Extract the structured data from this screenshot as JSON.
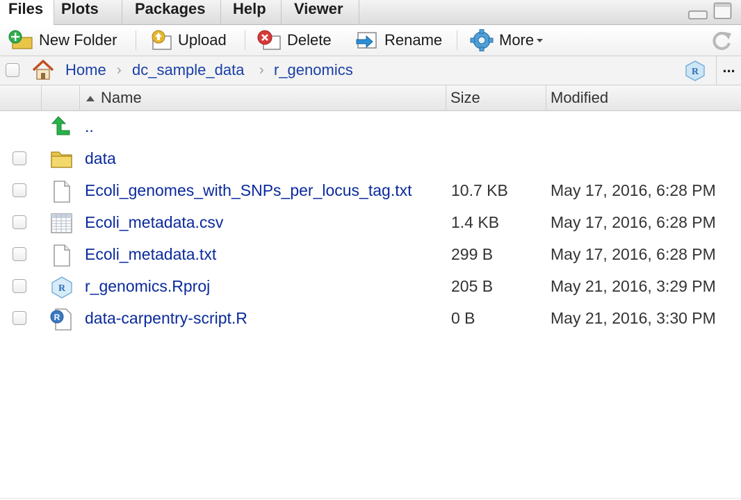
{
  "tabs": [
    {
      "label": "Files"
    },
    {
      "label": "Plots"
    },
    {
      "label": "Packages"
    },
    {
      "label": "Help"
    },
    {
      "label": "Viewer"
    }
  ],
  "toolbar": {
    "new_folder": "New Folder",
    "upload": "Upload",
    "delete": "Delete",
    "rename": "Rename",
    "more": "More"
  },
  "breadcrumb": {
    "items": [
      "Home",
      "dc_sample_data",
      "r_genomics"
    ],
    "more_label": "..."
  },
  "columns": {
    "name": "Name",
    "size": "Size",
    "modified": "Modified",
    "sort": "ascending"
  },
  "parent_dir": "..",
  "files": [
    {
      "name": "data",
      "size": "",
      "modified": "",
      "icon": "folder-icon"
    },
    {
      "name": "Ecoli_genomes_with_SNPs_per_locus_tag.txt",
      "size": "10.7 KB",
      "modified": "May 17, 2016, 6:28 PM",
      "icon": "text-file-icon"
    },
    {
      "name": "Ecoli_metadata.csv",
      "size": "1.4 KB",
      "modified": "May 17, 2016, 6:28 PM",
      "icon": "csv-file-icon"
    },
    {
      "name": "Ecoli_metadata.txt",
      "size": "299 B",
      "modified": "May 17, 2016, 6:28 PM",
      "icon": "text-file-icon"
    },
    {
      "name": "r_genomics.Rproj",
      "size": "205 B",
      "modified": "May 21, 2016, 3:29 PM",
      "icon": "rproj-icon"
    },
    {
      "name": "data-carpentry-script.R",
      "size": "0 B",
      "modified": "May 21, 2016, 3:30 PM",
      "icon": "r-script-icon"
    }
  ],
  "colors": {
    "link": "#0b2a9c",
    "crumb": "#1a3fa8"
  }
}
